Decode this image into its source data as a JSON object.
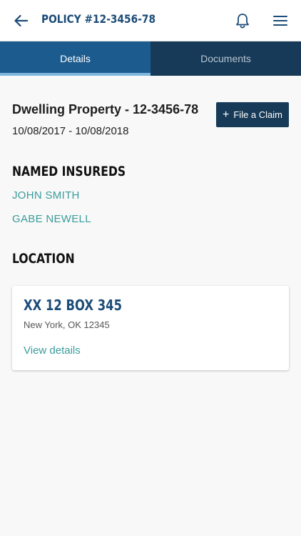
{
  "header": {
    "title": "POLICY #12-3456-78",
    "back_icon": "arrow-left-icon",
    "notifications_icon": "bell-icon",
    "menu_icon": "hamburger-menu-icon"
  },
  "tabs": [
    {
      "label": "Details",
      "selected": true
    },
    {
      "label": "Documents",
      "selected": false
    }
  ],
  "policy": {
    "name": "Dwelling Property - 12-3456-78",
    "dates": "10/08/2017 - 10/08/2018",
    "file_claim_label": "File a Claim",
    "file_claim_icon": "plus-icon"
  },
  "named_insureds": {
    "heading": "NAMED INSUREDS",
    "names": [
      "JOHN SMITH",
      "GABE NEWELL"
    ]
  },
  "location": {
    "heading": "LOCATION",
    "address": "XX 12 BOX 345",
    "city_state_zip": "New York, OK 12345",
    "link_label": "View details"
  },
  "colors": {
    "header_text": "#1c4c78",
    "tab_active": "#1b5b8e",
    "tab_inactive": "#173a58",
    "tab_indicator": "#7fb6dd",
    "link": "#3b9c9c",
    "button": "#173a58",
    "background": "#f8f8f8"
  }
}
